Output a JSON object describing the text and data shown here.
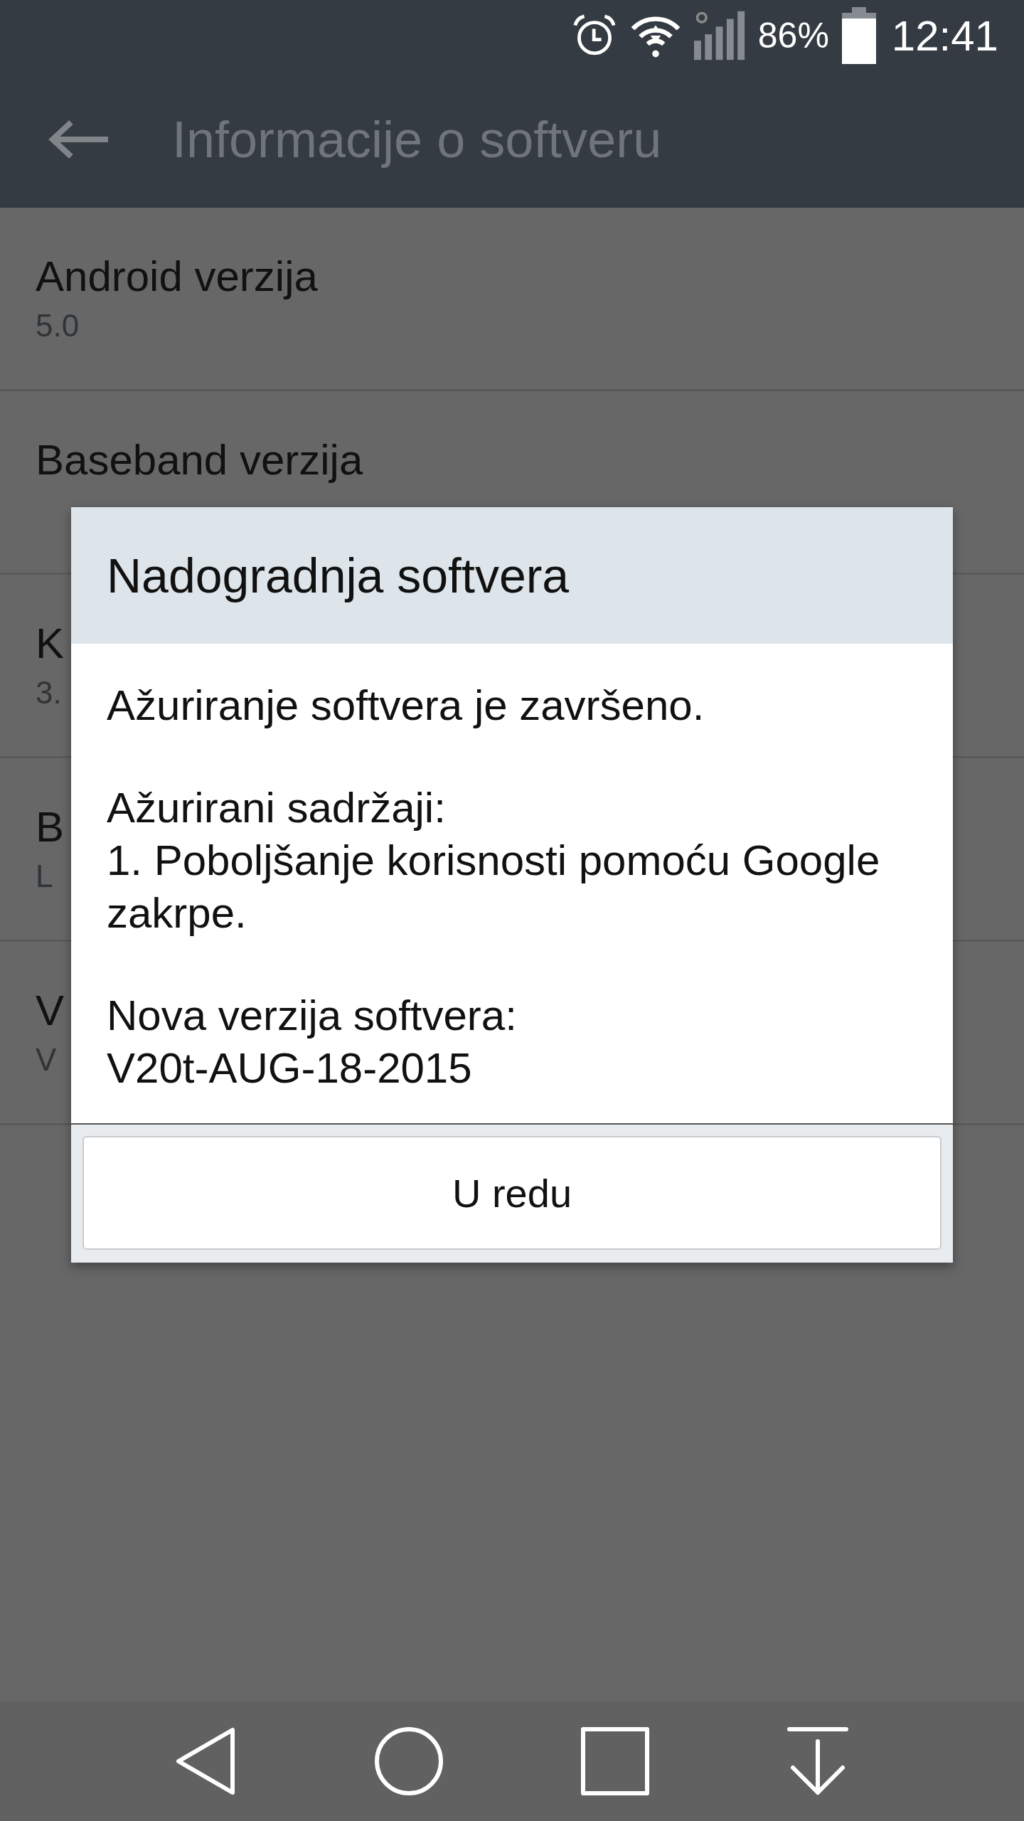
{
  "status_bar": {
    "battery_text": "86%",
    "time": "12:41"
  },
  "toolbar": {
    "title": "Informacije o softveru"
  },
  "list": [
    {
      "title": "Android verzija",
      "value": "5.0"
    },
    {
      "title": "Baseband verzija"
    },
    {
      "title": "K",
      "value": "3."
    },
    {
      "title": "B",
      "value": "L"
    },
    {
      "title": "V",
      "value": "V"
    }
  ],
  "dialog": {
    "title": "Nadogradnja softvera",
    "paragraphs": [
      "Ažuriranje softvera je završeno.",
      "Ažurirani sadržaji:\n1. Poboljšanje korisnosti pomoću Google zakrpe.",
      "Nova verzija softvera:\nV20t-AUG-18-2015"
    ],
    "button": "U redu"
  }
}
